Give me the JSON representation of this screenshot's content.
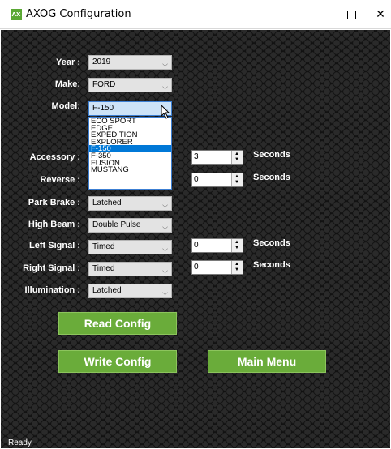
{
  "window": {
    "title": "AXOG Configuration",
    "icon_text": "AX",
    "icon_name": "app-logo-icon",
    "minimize_icon": "minimize-icon",
    "maximize_icon": "maximize-icon",
    "close_icon": "close-icon",
    "close_glyph": "✕"
  },
  "form": {
    "year": {
      "label": "Year :",
      "value": "2019"
    },
    "make": {
      "label": "Make:",
      "value": "FORD"
    },
    "model": {
      "label": "Model:",
      "value": "F-150",
      "options": [
        "ECO SPORT",
        "EDGE",
        "EXPEDITION",
        "EXPLORER",
        "F-150",
        "F-350",
        "FUSION",
        "MUSTANG"
      ],
      "selected_index": 4
    },
    "accessory": {
      "label": "Accessory :",
      "number": "3",
      "unit": "Seconds"
    },
    "reverse": {
      "label": "Reverse :",
      "number": "0",
      "unit": "Seconds"
    },
    "park_brake": {
      "label": "Park Brake :",
      "value": "Latched"
    },
    "high_beam": {
      "label": "High Beam :",
      "value": "Double Pulse"
    },
    "left_signal": {
      "label": "Left Signal :",
      "value": "Timed",
      "number": "0",
      "unit": "Seconds"
    },
    "right_signal": {
      "label": "Right Signal :",
      "value": "Timed",
      "number": "0",
      "unit": "Seconds"
    },
    "illumination": {
      "label": "Illumination :",
      "value": "Latched"
    }
  },
  "buttons": {
    "read_config": "Read Config",
    "write_config": "Write Config",
    "main_menu": "Main Menu"
  },
  "status": {
    "text": "Ready"
  },
  "colors": {
    "button_green": "#6aac3a",
    "selection_blue": "#0078d7",
    "background": "#161616"
  }
}
